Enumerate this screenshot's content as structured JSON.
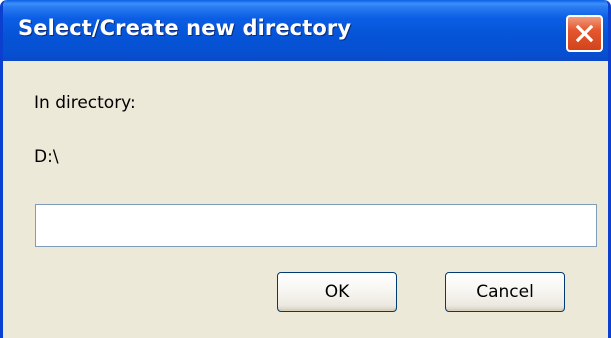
{
  "window": {
    "title": "Select/Create new directory",
    "close_icon": "close-icon"
  },
  "content": {
    "in_directory_label": "In directory:",
    "current_path": "D:\\",
    "directory_input": {
      "value": "",
      "placeholder": ""
    }
  },
  "buttons": {
    "ok_label": "OK",
    "cancel_label": "Cancel"
  },
  "colors": {
    "titlebar": "#0553d6",
    "dialog_background": "#ece9d8",
    "close_button": "#e4582f",
    "input_border": "#7f9db9",
    "button_border": "#003c74"
  }
}
